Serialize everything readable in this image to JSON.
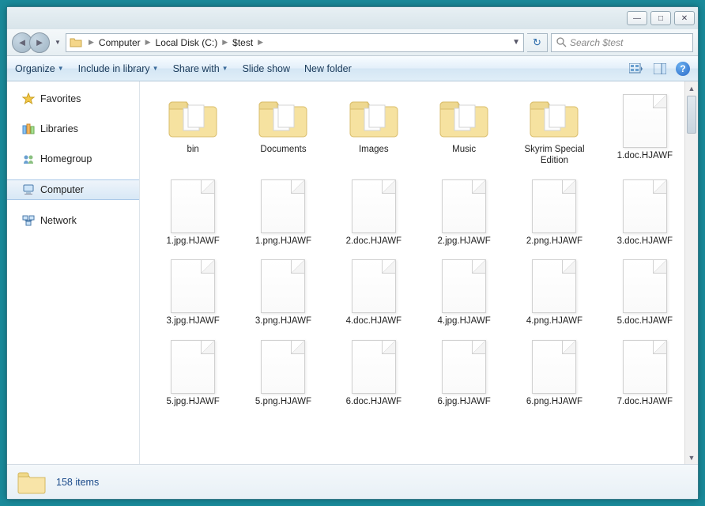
{
  "window_controls": {
    "min": "—",
    "max": "□",
    "close": "✕"
  },
  "breadcrumb": [
    "Computer",
    "Local Disk (C:)",
    "$test"
  ],
  "search": {
    "placeholder": "Search $test"
  },
  "toolbar": {
    "organize": "Organize",
    "include": "Include in library",
    "share": "Share with",
    "slideshow": "Slide show",
    "newfolder": "New folder"
  },
  "sidebar": {
    "favorites": "Favorites",
    "libraries": "Libraries",
    "homegroup": "Homegroup",
    "computer": "Computer",
    "network": "Network"
  },
  "items": [
    {
      "name": "bin",
      "type": "folder"
    },
    {
      "name": "Documents",
      "type": "folder"
    },
    {
      "name": "Images",
      "type": "folder"
    },
    {
      "name": "Music",
      "type": "folder"
    },
    {
      "name": "Skyrim Special Edition",
      "type": "folder"
    },
    {
      "name": "1.doc.HJAWF",
      "type": "file"
    },
    {
      "name": "1.jpg.HJAWF",
      "type": "file"
    },
    {
      "name": "1.png.HJAWF",
      "type": "file"
    },
    {
      "name": "2.doc.HJAWF",
      "type": "file"
    },
    {
      "name": "2.jpg.HJAWF",
      "type": "file"
    },
    {
      "name": "2.png.HJAWF",
      "type": "file"
    },
    {
      "name": "3.doc.HJAWF",
      "type": "file"
    },
    {
      "name": "3.jpg.HJAWF",
      "type": "file"
    },
    {
      "name": "3.png.HJAWF",
      "type": "file"
    },
    {
      "name": "4.doc.HJAWF",
      "type": "file"
    },
    {
      "name": "4.jpg.HJAWF",
      "type": "file"
    },
    {
      "name": "4.png.HJAWF",
      "type": "file"
    },
    {
      "name": "5.doc.HJAWF",
      "type": "file"
    },
    {
      "name": "5.jpg.HJAWF",
      "type": "file"
    },
    {
      "name": "5.png.HJAWF",
      "type": "file"
    },
    {
      "name": "6.doc.HJAWF",
      "type": "file"
    },
    {
      "name": "6.jpg.HJAWF",
      "type": "file"
    },
    {
      "name": "6.png.HJAWF",
      "type": "file"
    },
    {
      "name": "7.doc.HJAWF",
      "type": "file"
    }
  ],
  "status": {
    "count": "158 items"
  }
}
